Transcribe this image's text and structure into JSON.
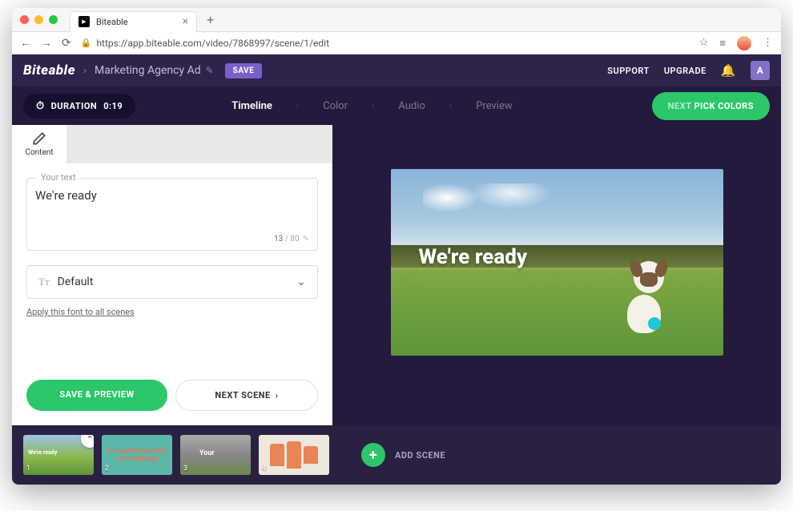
{
  "browser": {
    "tab_title": "Biteable",
    "url": "https://app.biteable.com/video/7868997/scene/1/edit"
  },
  "header": {
    "brand": "Biteable",
    "project_name": "Marketing Agency Ad",
    "save_label": "SAVE",
    "support_label": "SUPPORT",
    "upgrade_label": "UPGRADE",
    "user_initial": "A"
  },
  "subheader": {
    "duration_label": "DURATION",
    "duration_value": "0:19",
    "steps": [
      "Timeline",
      "Color",
      "Audio",
      "Preview"
    ],
    "active_step": "Timeline",
    "next_prefix": "NEXT",
    "next_action": "PICK COLORS"
  },
  "editor": {
    "content_tab": "Content",
    "your_text_label": "Your text",
    "text_value": "We're ready",
    "char_current": "13",
    "char_max": "80",
    "font_value": "Default",
    "apply_font_link": "Apply this font to all scenes",
    "save_preview_btn": "SAVE & PREVIEW",
    "next_scene_btn": "NEXT SCENE"
  },
  "preview": {
    "overlay_text": "We're ready"
  },
  "timeline": {
    "thumbs": [
      {
        "num": "1",
        "text": "We're ready"
      },
      {
        "num": "2",
        "text": "to supercharge your next campaign."
      },
      {
        "num": "3",
        "text": "Your"
      },
      {
        "num": "4",
        "text": ""
      }
    ],
    "add_scene_label": "ADD SCENE"
  }
}
